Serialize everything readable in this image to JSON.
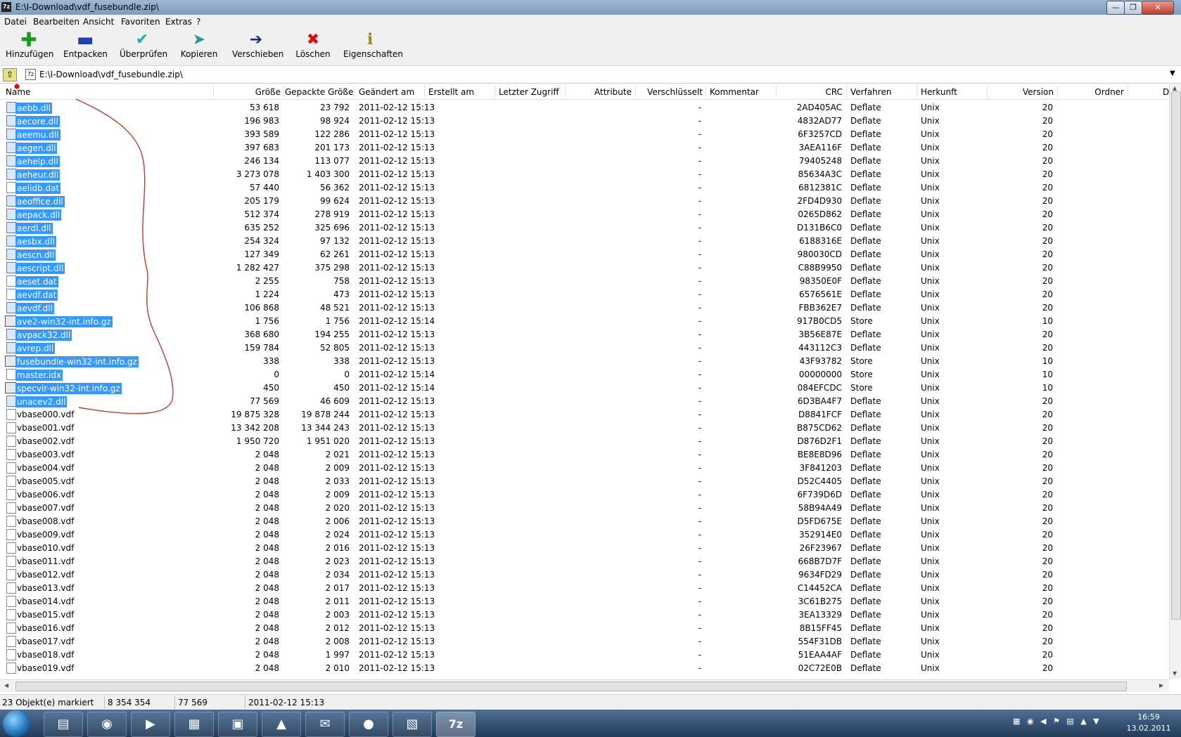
{
  "window": {
    "title": "E:\\I-Download\\vdf_fusebundle.zip\\",
    "app_icon": "7z"
  },
  "menu": [
    "Datei",
    "Bearbeiten",
    "Ansicht",
    "Favoriten",
    "Extras",
    "?"
  ],
  "toolbar": [
    {
      "label": "Hinzufügen",
      "icon": "plus-icon"
    },
    {
      "label": "Entpacken",
      "icon": "minus-icon"
    },
    {
      "label": "Überprüfen",
      "icon": "check-icon"
    },
    {
      "label": "Kopieren",
      "icon": "copy-arrow-icon"
    },
    {
      "label": "Verschieben",
      "icon": "move-arrow-icon"
    },
    {
      "label": "Löschen",
      "icon": "delete-x-icon"
    },
    {
      "label": "Eigenschaften",
      "icon": "info-icon"
    }
  ],
  "address": {
    "path": "E:\\I-Download\\vdf_fusebundle.zip\\"
  },
  "columns": [
    "Name",
    "Größe",
    "Gepackte Größe",
    "Geändert am",
    "Erstellt am",
    "Letzter Zugriff",
    "Attribute",
    "Verschlüsselt",
    "Kommentar",
    "CRC",
    "Verfahren",
    "Herkunft",
    "Version",
    "Ordner",
    "D"
  ],
  "files": [
    {
      "name": "aebb.dll",
      "size": "53 618",
      "packed": "23 792",
      "modified": "2011-02-12 15:13",
      "enc": "-",
      "crc": "2AD405AC",
      "method": "Deflate",
      "host": "Unix",
      "version": "20",
      "type": "dll",
      "selected": true
    },
    {
      "name": "aecore.dll",
      "size": "196 983",
      "packed": "98 924",
      "modified": "2011-02-12 15:13",
      "enc": "-",
      "crc": "4832AD77",
      "method": "Deflate",
      "host": "Unix",
      "version": "20",
      "type": "dll",
      "selected": true
    },
    {
      "name": "aeemu.dll",
      "size": "393 589",
      "packed": "122 286",
      "modified": "2011-02-12 15:13",
      "enc": "-",
      "crc": "6F3257CD",
      "method": "Deflate",
      "host": "Unix",
      "version": "20",
      "type": "dll",
      "selected": true
    },
    {
      "name": "aegen.dll",
      "size": "397 683",
      "packed": "201 173",
      "modified": "2011-02-12 15:13",
      "enc": "-",
      "crc": "3AEA116F",
      "method": "Deflate",
      "host": "Unix",
      "version": "20",
      "type": "dll",
      "selected": true
    },
    {
      "name": "aehelp.dll",
      "size": "246 134",
      "packed": "113 077",
      "modified": "2011-02-12 15:13",
      "enc": "-",
      "crc": "79405248",
      "method": "Deflate",
      "host": "Unix",
      "version": "20",
      "type": "dll",
      "selected": true
    },
    {
      "name": "aeheur.dll",
      "size": "3 273 078",
      "packed": "1 403 300",
      "modified": "2011-02-12 15:13",
      "enc": "-",
      "crc": "85634A3C",
      "method": "Deflate",
      "host": "Unix",
      "version": "20",
      "type": "dll",
      "selected": true
    },
    {
      "name": "aelidb.dat",
      "size": "57 440",
      "packed": "56 362",
      "modified": "2011-02-12 15:13",
      "enc": "-",
      "crc": "6812381C",
      "method": "Deflate",
      "host": "Unix",
      "version": "20",
      "type": "file",
      "selected": true
    },
    {
      "name": "aeoffice.dll",
      "size": "205 179",
      "packed": "99 624",
      "modified": "2011-02-12 15:13",
      "enc": "-",
      "crc": "2FD4D930",
      "method": "Deflate",
      "host": "Unix",
      "version": "20",
      "type": "dll",
      "selected": true
    },
    {
      "name": "aepack.dll",
      "size": "512 374",
      "packed": "278 919",
      "modified": "2011-02-12 15:13",
      "enc": "-",
      "crc": "0265D862",
      "method": "Deflate",
      "host": "Unix",
      "version": "20",
      "type": "dll",
      "selected": true
    },
    {
      "name": "aerdl.dll",
      "size": "635 252",
      "packed": "325 696",
      "modified": "2011-02-12 15:13",
      "enc": "-",
      "crc": "D131B6C0",
      "method": "Deflate",
      "host": "Unix",
      "version": "20",
      "type": "dll",
      "selected": true
    },
    {
      "name": "aesbx.dll",
      "size": "254 324",
      "packed": "97 132",
      "modified": "2011-02-12 15:13",
      "enc": "-",
      "crc": "6188316E",
      "method": "Deflate",
      "host": "Unix",
      "version": "20",
      "type": "dll",
      "selected": true
    },
    {
      "name": "aescn.dll",
      "size": "127 349",
      "packed": "62 261",
      "modified": "2011-02-12 15:13",
      "enc": "-",
      "crc": "980030CD",
      "method": "Deflate",
      "host": "Unix",
      "version": "20",
      "type": "dll",
      "selected": true
    },
    {
      "name": "aescript.dll",
      "size": "1 282 427",
      "packed": "375 298",
      "modified": "2011-02-12 15:13",
      "enc": "-",
      "crc": "C88B9950",
      "method": "Deflate",
      "host": "Unix",
      "version": "20",
      "type": "dll",
      "selected": true
    },
    {
      "name": "aeset.dat",
      "size": "2 255",
      "packed": "758",
      "modified": "2011-02-12 15:13",
      "enc": "-",
      "crc": "98350E0F",
      "method": "Deflate",
      "host": "Unix",
      "version": "20",
      "type": "file",
      "selected": true
    },
    {
      "name": "aevdf.dat",
      "size": "1 224",
      "packed": "473",
      "modified": "2011-02-12 15:13",
      "enc": "-",
      "crc": "6576561E",
      "method": "Deflate",
      "host": "Unix",
      "version": "20",
      "type": "file",
      "selected": true
    },
    {
      "name": "aevdf.dll",
      "size": "106 868",
      "packed": "48 521",
      "modified": "2011-02-12 15:13",
      "enc": "-",
      "crc": "FBB362E7",
      "method": "Deflate",
      "host": "Unix",
      "version": "20",
      "type": "dll",
      "selected": true
    },
    {
      "name": "ave2-win32-int.info.gz",
      "size": "1 756",
      "packed": "1 756",
      "modified": "2011-02-12 15:14",
      "enc": "-",
      "crc": "917B0CD5",
      "method": "Store",
      "host": "Unix",
      "version": "10",
      "type": "gz",
      "selected": true
    },
    {
      "name": "avpack32.dll",
      "size": "368 680",
      "packed": "194 255",
      "modified": "2011-02-12 15:13",
      "enc": "-",
      "crc": "3B56E87E",
      "method": "Deflate",
      "host": "Unix",
      "version": "20",
      "type": "dll",
      "selected": true
    },
    {
      "name": "avrep.dll",
      "size": "159 784",
      "packed": "52 805",
      "modified": "2011-02-12 15:13",
      "enc": "-",
      "crc": "443112C3",
      "method": "Deflate",
      "host": "Unix",
      "version": "20",
      "type": "dll",
      "selected": true
    },
    {
      "name": "fusebundle-win32-int.info.gz",
      "size": "338",
      "packed": "338",
      "modified": "2011-02-12 15:13",
      "enc": "-",
      "crc": "43F93782",
      "method": "Store",
      "host": "Unix",
      "version": "10",
      "type": "gz",
      "selected": true
    },
    {
      "name": "master.idx",
      "size": "0",
      "packed": "0",
      "modified": "2011-02-12 15:14",
      "enc": "-",
      "crc": "00000000",
      "method": "Store",
      "host": "Unix",
      "version": "10",
      "type": "file",
      "selected": true
    },
    {
      "name": "specvir-win32-int.info.gz",
      "size": "450",
      "packed": "450",
      "modified": "2011-02-12 15:14",
      "enc": "-",
      "crc": "084EFCDC",
      "method": "Store",
      "host": "Unix",
      "version": "10",
      "type": "gz",
      "selected": true
    },
    {
      "name": "unacev2.dll",
      "size": "77 569",
      "packed": "46 609",
      "modified": "2011-02-12 15:13",
      "enc": "-",
      "crc": "6D3BA4F7",
      "method": "Deflate",
      "host": "Unix",
      "version": "20",
      "type": "dll",
      "selected": true
    },
    {
      "name": "vbase000.vdf",
      "size": "19 875 328",
      "packed": "19 878 244",
      "modified": "2011-02-12 15:13",
      "enc": "-",
      "crc": "D8841FCF",
      "method": "Deflate",
      "host": "Unix",
      "version": "20",
      "type": "file",
      "selected": false
    },
    {
      "name": "vbase001.vdf",
      "size": "13 342 208",
      "packed": "13 344 243",
      "modified": "2011-02-12 15:13",
      "enc": "-",
      "crc": "B875CD62",
      "method": "Deflate",
      "host": "Unix",
      "version": "20",
      "type": "file",
      "selected": false
    },
    {
      "name": "vbase002.vdf",
      "size": "1 950 720",
      "packed": "1 951 020",
      "modified": "2011-02-12 15:13",
      "enc": "-",
      "crc": "D876D2F1",
      "method": "Deflate",
      "host": "Unix",
      "version": "20",
      "type": "file",
      "selected": false
    },
    {
      "name": "vbase003.vdf",
      "size": "2 048",
      "packed": "2 021",
      "modified": "2011-02-12 15:13",
      "enc": "-",
      "crc": "BE8E8D96",
      "method": "Deflate",
      "host": "Unix",
      "version": "20",
      "type": "file",
      "selected": false
    },
    {
      "name": "vbase004.vdf",
      "size": "2 048",
      "packed": "2 009",
      "modified": "2011-02-12 15:13",
      "enc": "-",
      "crc": "3F841203",
      "method": "Deflate",
      "host": "Unix",
      "version": "20",
      "type": "file",
      "selected": false
    },
    {
      "name": "vbase005.vdf",
      "size": "2 048",
      "packed": "2 033",
      "modified": "2011-02-12 15:13",
      "enc": "-",
      "crc": "D52C4405",
      "method": "Deflate",
      "host": "Unix",
      "version": "20",
      "type": "file",
      "selected": false
    },
    {
      "name": "vbase006.vdf",
      "size": "2 048",
      "packed": "2 009",
      "modified": "2011-02-12 15:13",
      "enc": "-",
      "crc": "6F739D6D",
      "method": "Deflate",
      "host": "Unix",
      "version": "20",
      "type": "file",
      "selected": false
    },
    {
      "name": "vbase007.vdf",
      "size": "2 048",
      "packed": "2 020",
      "modified": "2011-02-12 15:13",
      "enc": "-",
      "crc": "58B94A49",
      "method": "Deflate",
      "host": "Unix",
      "version": "20",
      "type": "file",
      "selected": false
    },
    {
      "name": "vbase008.vdf",
      "size": "2 048",
      "packed": "2 006",
      "modified": "2011-02-12 15:13",
      "enc": "-",
      "crc": "D5FD675E",
      "method": "Deflate",
      "host": "Unix",
      "version": "20",
      "type": "file",
      "selected": false
    },
    {
      "name": "vbase009.vdf",
      "size": "2 048",
      "packed": "2 024",
      "modified": "2011-02-12 15:13",
      "enc": "-",
      "crc": "352914E0",
      "method": "Deflate",
      "host": "Unix",
      "version": "20",
      "type": "file",
      "selected": false
    },
    {
      "name": "vbase010.vdf",
      "size": "2 048",
      "packed": "2 016",
      "modified": "2011-02-12 15:13",
      "enc": "-",
      "crc": "26F23967",
      "method": "Deflate",
      "host": "Unix",
      "version": "20",
      "type": "file",
      "selected": false
    },
    {
      "name": "vbase011.vdf",
      "size": "2 048",
      "packed": "2 023",
      "modified": "2011-02-12 15:13",
      "enc": "-",
      "crc": "668B7D7F",
      "method": "Deflate",
      "host": "Unix",
      "version": "20",
      "type": "file",
      "selected": false
    },
    {
      "name": "vbase012.vdf",
      "size": "2 048",
      "packed": "2 034",
      "modified": "2011-02-12 15:13",
      "enc": "-",
      "crc": "9634FD29",
      "method": "Deflate",
      "host": "Unix",
      "version": "20",
      "type": "file",
      "selected": false
    },
    {
      "name": "vbase013.vdf",
      "size": "2 048",
      "packed": "2 017",
      "modified": "2011-02-12 15:13",
      "enc": "-",
      "crc": "C14452CA",
      "method": "Deflate",
      "host": "Unix",
      "version": "20",
      "type": "file",
      "selected": false
    },
    {
      "name": "vbase014.vdf",
      "size": "2 048",
      "packed": "2 011",
      "modified": "2011-02-12 15:13",
      "enc": "-",
      "crc": "3C61B275",
      "method": "Deflate",
      "host": "Unix",
      "version": "20",
      "type": "file",
      "selected": false
    },
    {
      "name": "vbase015.vdf",
      "size": "2 048",
      "packed": "2 003",
      "modified": "2011-02-12 15:13",
      "enc": "-",
      "crc": "3EA13329",
      "method": "Deflate",
      "host": "Unix",
      "version": "20",
      "type": "file",
      "selected": false
    },
    {
      "name": "vbase016.vdf",
      "size": "2 048",
      "packed": "2 012",
      "modified": "2011-02-12 15:13",
      "enc": "-",
      "crc": "8B15FF45",
      "method": "Deflate",
      "host": "Unix",
      "version": "20",
      "type": "file",
      "selected": false
    },
    {
      "name": "vbase017.vdf",
      "size": "2 048",
      "packed": "2 008",
      "modified": "2011-02-12 15:13",
      "enc": "-",
      "crc": "554F31DB",
      "method": "Deflate",
      "host": "Unix",
      "version": "20",
      "type": "file",
      "selected": false
    },
    {
      "name": "vbase018.vdf",
      "size": "2 048",
      "packed": "1 997",
      "modified": "2011-02-12 15:13",
      "enc": "-",
      "crc": "51EAA4AF",
      "method": "Deflate",
      "host": "Unix",
      "version": "20",
      "type": "file",
      "selected": false
    },
    {
      "name": "vbase019.vdf",
      "size": "2 048",
      "packed": "2 010",
      "modified": "2011-02-12 15:13",
      "enc": "-",
      "crc": "02C72E0B",
      "method": "Deflate",
      "host": "Unix",
      "version": "20",
      "type": "file",
      "selected": false
    }
  ],
  "status": {
    "selection": "23 Objekt(e) markiert",
    "total_size": "8 354 354",
    "packed_size": "77 569",
    "date": "2011-02-12 15:13"
  },
  "taskbar": {
    "items": [
      "explorer-icon",
      "ccleaner-icon",
      "media-player-icon",
      "virtualdub-icon",
      "calendar-icon",
      "avira-icon",
      "email-icon",
      "firefox-icon",
      "folder-icon",
      "7zip-icon"
    ],
    "active_label": "7z"
  },
  "clock": {
    "time": "16:59",
    "date": "13.02.2011"
  },
  "colors": {
    "selection": "#3399ff",
    "annotation": "#c0392b",
    "taskbar": "#2f4c6e"
  }
}
